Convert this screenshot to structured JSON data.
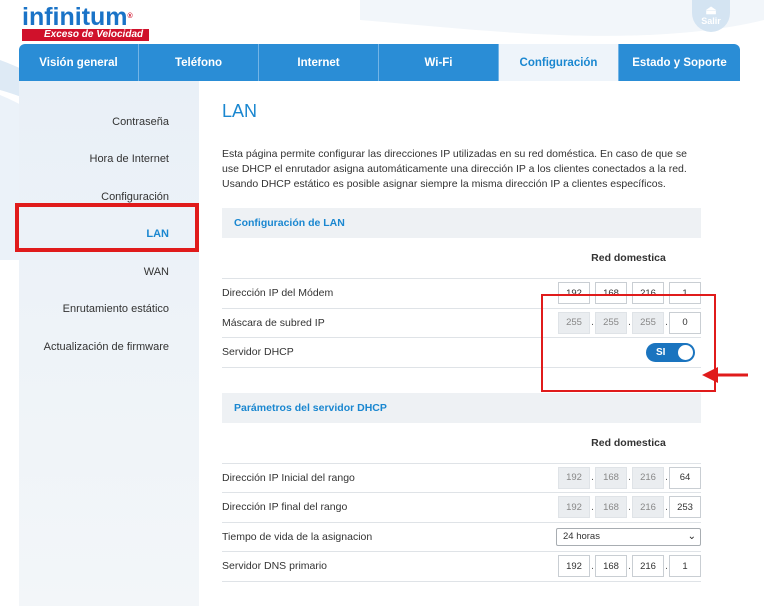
{
  "header": {
    "logo_text": "infinitum",
    "logo_registered": "®",
    "logo_tagline": "Exceso de Velocidad",
    "logout_label": "Salir"
  },
  "nav": {
    "tabs": [
      {
        "label": "Visión general"
      },
      {
        "label": "Teléfono"
      },
      {
        "label": "Internet"
      },
      {
        "label": "Wi-Fi"
      },
      {
        "label": "Configuración",
        "active": true
      },
      {
        "label": "Estado y Soporte"
      }
    ]
  },
  "sidebar": {
    "items": [
      {
        "label": "Contraseña"
      },
      {
        "label": "Hora de Internet"
      },
      {
        "label": "Configuración"
      },
      {
        "label": "LAN",
        "active": true
      },
      {
        "label": "WAN"
      },
      {
        "label": "Enrutamiento estático"
      },
      {
        "label": "Actualización de firmware"
      }
    ]
  },
  "main": {
    "title": "LAN",
    "description": "Esta página permite configurar las direcciones IP utilizadas en su red doméstica. En caso de que se use DHCP el enrutador asigna automáticamente una dirección IP a los clientes conectados a la red. Usando DHCP estático es posible asignar siempre la misma dirección IP a clientes específicos.",
    "lan_section": {
      "title": "Configuración de LAN",
      "column_header": "Red domestica",
      "modem_ip": {
        "label": "Dirección IP del Módem",
        "octets": [
          "192",
          "168",
          "216",
          "1"
        ]
      },
      "subnet_mask": {
        "label": "Máscara de subred IP",
        "octets": [
          "255",
          "255",
          "255",
          "0"
        ]
      },
      "dhcp_server": {
        "label": "Servidor DHCP",
        "toggle_label": "SI",
        "enabled": true
      }
    },
    "dhcp_section": {
      "title": "Parámetros del servidor DHCP",
      "column_header": "Red domestica",
      "range_start": {
        "label": "Dirección IP Inicial del rango",
        "octets": [
          "192",
          "168",
          "216",
          "64"
        ]
      },
      "range_end": {
        "label": "Dirección IP final del rango",
        "octets": [
          "192",
          "168",
          "216",
          "253"
        ]
      },
      "lease_time": {
        "label": "Tiempo de vida de la asignacion",
        "value": "24 horas"
      },
      "primary_dns": {
        "label": "Servidor DNS primario",
        "octets": [
          "192",
          "168",
          "216",
          "1"
        ]
      }
    }
  },
  "colors": {
    "brand_blue": "#2a8dd6",
    "accent_red": "#d0112b",
    "highlight_red": "#e01b1b",
    "toggle_blue": "#1a74bf"
  }
}
